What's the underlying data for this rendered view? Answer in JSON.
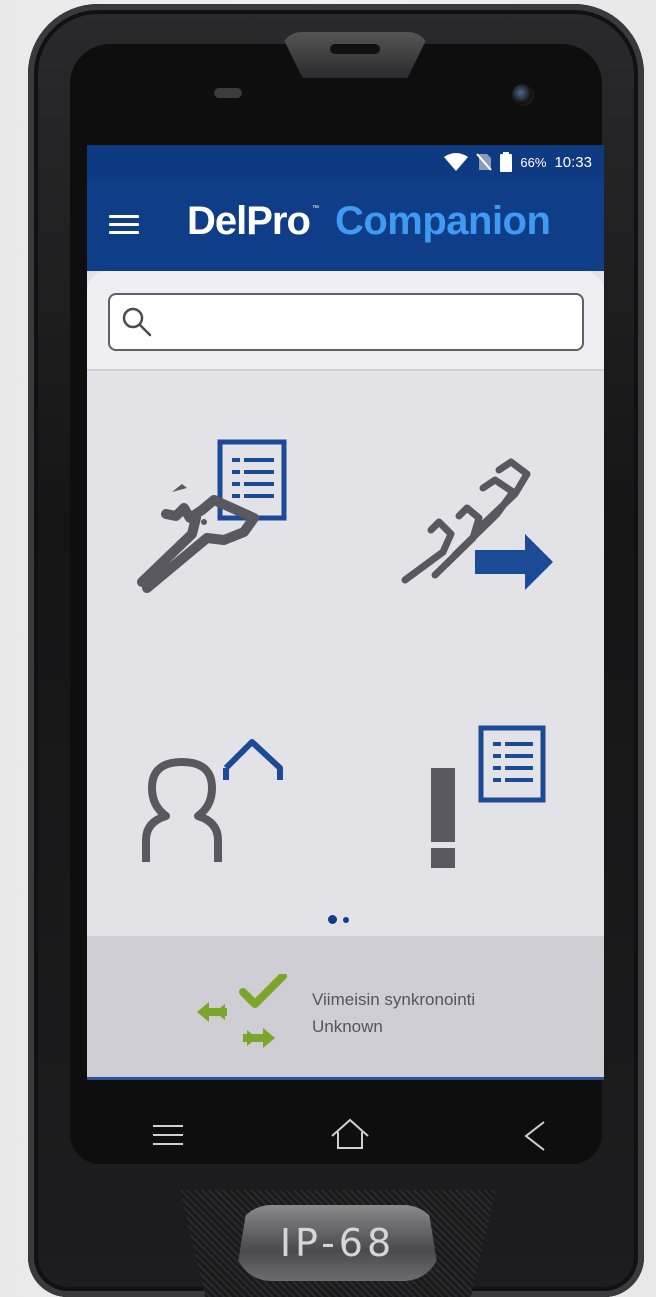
{
  "status_bar": {
    "battery_percent": "66%",
    "time": "10:33",
    "icons": [
      "wifi-icon",
      "no-sim-icon",
      "battery-icon"
    ]
  },
  "app_bar": {
    "brand_primary": "DelPro",
    "brand_trademark": "™",
    "brand_secondary": "Companion",
    "menu_icon": "hamburger-menu-icon"
  },
  "search": {
    "placeholder": "",
    "value": ""
  },
  "tiles": [
    {
      "icon": "animal-card-icon"
    },
    {
      "icon": "animal-group-move-icon"
    },
    {
      "icon": "user-home-icon"
    },
    {
      "icon": "alarm-list-icon"
    }
  ],
  "pager": {
    "pages": 2,
    "active": 0
  },
  "sync": {
    "label": "Viimeisin synkronointi",
    "status": "Unknown"
  },
  "device": {
    "rating": "IP-68"
  },
  "colors": {
    "primary": "#0f3d87",
    "accent": "#3f9bf2",
    "icon_grey": "#58585e",
    "icon_blue": "#1b4a96",
    "sync_green": "#7aa72a"
  }
}
